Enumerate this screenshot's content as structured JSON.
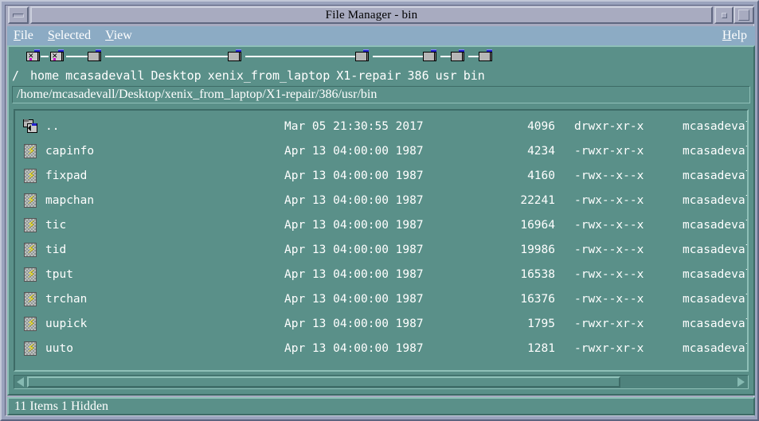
{
  "window": {
    "title": "File Manager - bin",
    "menu_button_icon": "window-menu-icon",
    "minimize_icon": "minimize-icon",
    "maximize_icon": "maximize-icon"
  },
  "menubar": {
    "items": [
      {
        "label": "File",
        "mnemonic": "F",
        "rest": "ile"
      },
      {
        "label": "Selected",
        "mnemonic": "S",
        "rest": "elected"
      },
      {
        "label": "View",
        "mnemonic": "V",
        "rest": "iew"
      }
    ],
    "help": {
      "label": "Help",
      "mnemonic": "H",
      "rest": "elp"
    }
  },
  "breadcrumb": {
    "segments": [
      {
        "label": "/",
        "icon": "x-folder-icon"
      },
      {
        "label": "home",
        "icon": "x-folder-icon"
      },
      {
        "label": "mcasadevall",
        "icon": "folder-icon"
      },
      {
        "label": "Desktop",
        "icon": "folder-icon"
      },
      {
        "label": "xenix_from_laptop",
        "icon": "folder-icon"
      },
      {
        "label": "X1-repair",
        "icon": "folder-icon"
      },
      {
        "label": "386",
        "icon": "folder-icon"
      },
      {
        "label": "usr",
        "icon": "folder-icon"
      },
      {
        "label": "bin",
        "icon": "folder-icon"
      }
    ]
  },
  "path_field": {
    "value": "/home/mcasadevall/Desktop/xenix_from_laptop/X1-repair/386/usr/bin"
  },
  "file_list": {
    "rows": [
      {
        "icon": "parent-folder-icon",
        "name": "..",
        "date": "Mar 05 21:30:55 2017",
        "size": "4096",
        "perms": "drwxr-xr-x",
        "owner": "mcasadevall"
      },
      {
        "icon": "executable-icon",
        "name": "capinfo",
        "date": "Apr 13 04:00:00 1987",
        "size": "4234",
        "perms": "-rwxr-xr-x",
        "owner": "mcasadevall"
      },
      {
        "icon": "executable-icon",
        "name": "fixpad",
        "date": "Apr 13 04:00:00 1987",
        "size": "4160",
        "perms": "-rwx--x--x",
        "owner": "mcasadevall"
      },
      {
        "icon": "executable-icon",
        "name": "mapchan",
        "date": "Apr 13 04:00:00 1987",
        "size": "22241",
        "perms": "-rwx--x--x",
        "owner": "mcasadevall"
      },
      {
        "icon": "executable-icon",
        "name": "tic",
        "date": "Apr 13 04:00:00 1987",
        "size": "16964",
        "perms": "-rwx--x--x",
        "owner": "mcasadevall"
      },
      {
        "icon": "executable-icon",
        "name": "tid",
        "date": "Apr 13 04:00:00 1987",
        "size": "19986",
        "perms": "-rwx--x--x",
        "owner": "mcasadevall"
      },
      {
        "icon": "executable-icon",
        "name": "tput",
        "date": "Apr 13 04:00:00 1987",
        "size": "16538",
        "perms": "-rwx--x--x",
        "owner": "mcasadevall"
      },
      {
        "icon": "executable-icon",
        "name": "trchan",
        "date": "Apr 13 04:00:00 1987",
        "size": "16376",
        "perms": "-rwx--x--x",
        "owner": "mcasadevall"
      },
      {
        "icon": "executable-icon",
        "name": "uupick",
        "date": "Apr 13 04:00:00 1987",
        "size": "1795",
        "perms": "-rwxr-xr-x",
        "owner": "mcasadevall"
      },
      {
        "icon": "executable-icon",
        "name": "uuto",
        "date": "Apr 13 04:00:00 1987",
        "size": "1281",
        "perms": "-rwxr-xr-x",
        "owner": "mcasadevall"
      }
    ]
  },
  "scrollbar": {
    "left_arrow_icon": "scroll-left-icon",
    "right_arrow_icon": "scroll-right-icon"
  },
  "status_bar": {
    "text": "11 Items 1 Hidden"
  },
  "colors": {
    "titlebar": "#a8abc0",
    "menubar": "#8cabc4",
    "client_teal": "#5a9089",
    "frame": "#9aa3bd",
    "text_white": "#ffffff"
  }
}
